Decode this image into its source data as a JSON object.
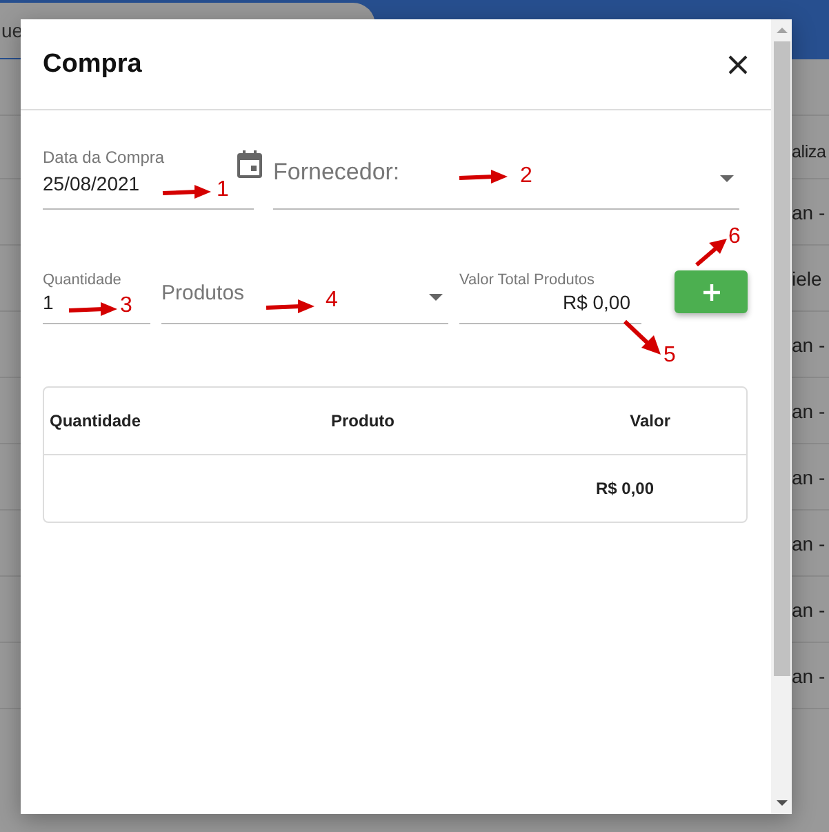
{
  "background": {
    "search_text": "ue",
    "column_header": "aliza",
    "rows": [
      "an -",
      "iele",
      "an -",
      "an -",
      "an -",
      "an -",
      "an -",
      "an -"
    ]
  },
  "dialog": {
    "title": "Compra",
    "date_field": {
      "label": "Data da Compra",
      "value": "25/08/2021"
    },
    "supplier_field": {
      "placeholder": "Fornecedor:"
    },
    "quantity_field": {
      "label": "Quantidade",
      "value": "1"
    },
    "products_field": {
      "placeholder": "Produtos"
    },
    "total_field": {
      "label": "Valor Total Produtos",
      "value": "R$ 0,00"
    },
    "table": {
      "columns": [
        "Quantidade",
        "Produto",
        "Valor"
      ],
      "total": "R$ 0,00"
    }
  },
  "annotations": [
    {
      "label": "1",
      "kind": "right"
    },
    {
      "label": "2",
      "kind": "right"
    },
    {
      "label": "3",
      "kind": "right"
    },
    {
      "label": "4",
      "kind": "right"
    },
    {
      "label": "5",
      "kind": "down"
    },
    {
      "label": "6",
      "kind": "up"
    }
  ]
}
